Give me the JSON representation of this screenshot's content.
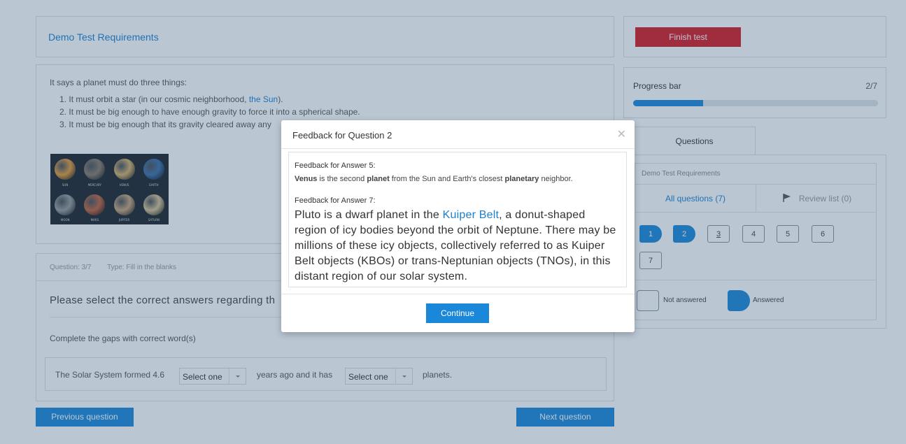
{
  "test_title": "Demo Test Requirements",
  "content": {
    "intro": "It says a planet must do three things:",
    "items": [
      {
        "num": "1.",
        "text": "It must orbit a star (in our cosmic neighborhood, ",
        "link": "the Sun",
        "after": ")."
      },
      {
        "num": "2.",
        "text": "It must be big enough to have enough gravity to force it into a spherical shape."
      },
      {
        "num": "3.",
        "text": "It must be big enough that its gravity cleared away any"
      }
    ],
    "planets": [
      {
        "name": "SUN",
        "color": "#e59a3a"
      },
      {
        "name": "MERCURY",
        "color": "#8a7a6a"
      },
      {
        "name": "VENUS",
        "color": "#d6b06a"
      },
      {
        "name": "EARTH",
        "color": "#3d6fa8"
      },
      {
        "name": "MOON",
        "color": "#9a9a9a"
      },
      {
        "name": "MARS",
        "color": "#c2613a"
      },
      {
        "name": "JUPITER",
        "color": "#c9a37a"
      },
      {
        "name": "SATURN",
        "color": "#d8c090"
      }
    ]
  },
  "question": {
    "number": "Question: 3/7",
    "type": "Type: Fill in the blanks",
    "title": "Please select the correct answers regarding th",
    "instruction": "Complete the gaps with correct word(s)",
    "seg1": "The Solar System formed 4.6",
    "select1": "Select one",
    "seg2": "years ago and it has",
    "select2": "Select one",
    "seg3": "planets."
  },
  "nav": {
    "prev": "Previous question",
    "next": "Next question",
    "finish": "Finish test"
  },
  "progress": {
    "label": "Progress bar",
    "count": "2/7",
    "fraction": 0.2857
  },
  "sidebar": {
    "tab": "Questions",
    "header": "Demo Test Requirements",
    "all": "All questions (7)",
    "review": "Review list (0)",
    "questions": [
      {
        "label": "1",
        "answered": true
      },
      {
        "label": "2",
        "answered": true
      },
      {
        "label": "3",
        "answered": false
      },
      {
        "label": "4",
        "answered": false
      },
      {
        "label": "5",
        "answered": false
      },
      {
        "label": "6",
        "answered": false
      },
      {
        "label": "7",
        "answered": false
      }
    ],
    "legend_not": "Not answered",
    "legend_ans": "Answered"
  },
  "modal": {
    "title": "Feedback for Question 2",
    "fb1_heading": "Feedback for Answer 5:",
    "fb1_text_parts": [
      "Venus",
      " is the second ",
      "planet",
      " from the Sun and Earth's closest ",
      "planetary",
      " neighbor."
    ],
    "fb2_heading": "Feedback for Answer 7:",
    "fb2_pre": "Pluto is a dwarf planet in the ",
    "fb2_link": "Kuiper Belt",
    "fb2_post": ", a donut-shaped region of icy bodies beyond the orbit of Neptune. There may be millions of these icy objects, collectively referred to as Kuiper Belt objects (KBOs) or trans-Neptunian objects (TNOs), in this distant region of our solar system.",
    "continue": "Continue"
  },
  "colors": {
    "accent": "#1a87d9",
    "danger": "#d91a21"
  }
}
